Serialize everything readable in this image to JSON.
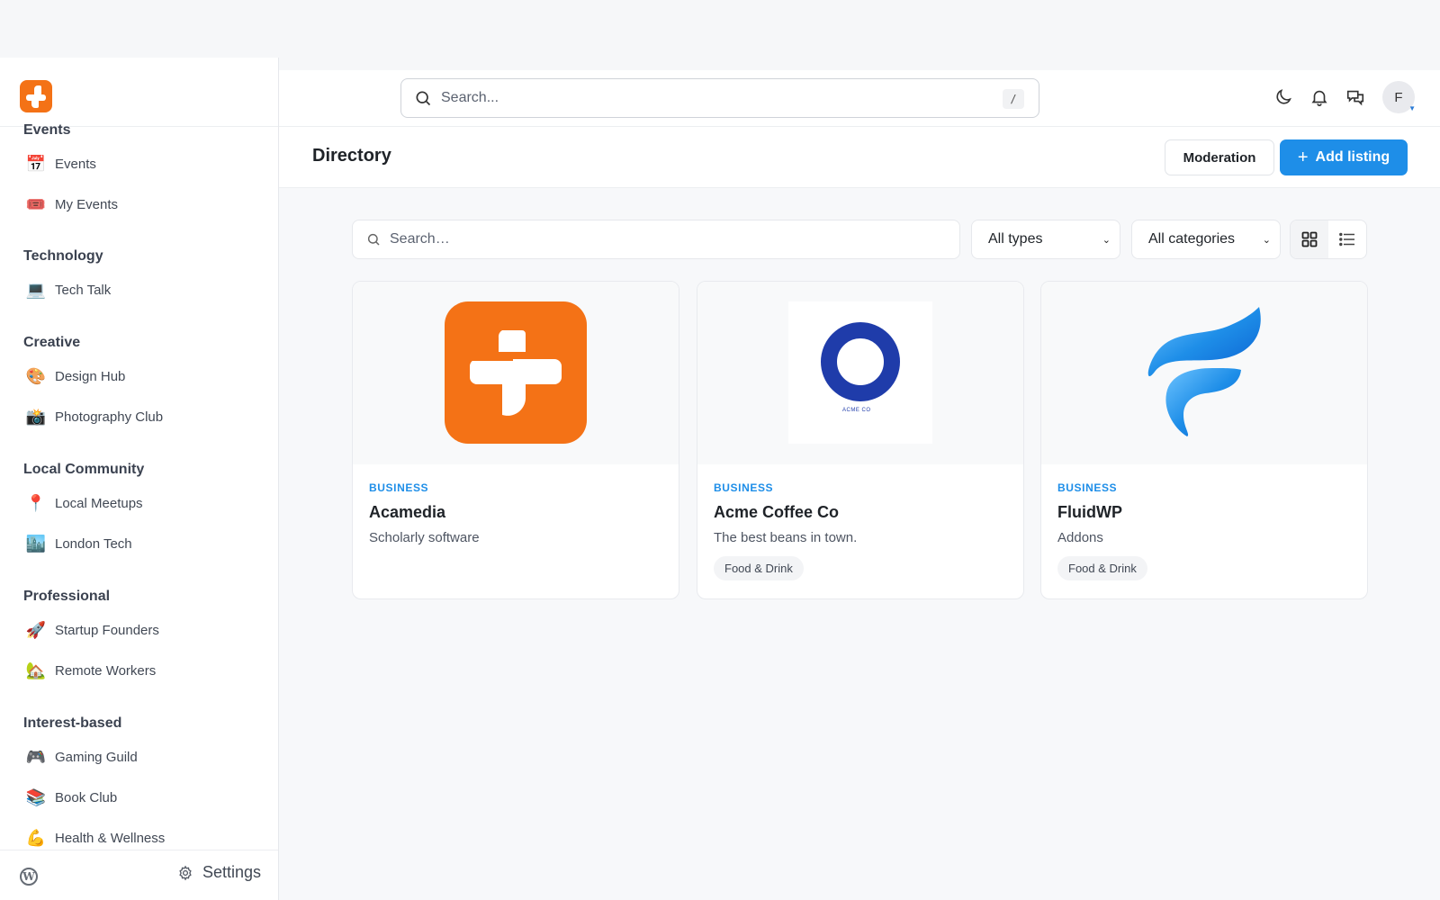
{
  "sidebar": {
    "sections": [
      {
        "title": "Events",
        "items": [
          {
            "label": "Events",
            "emoji": "📅"
          },
          {
            "label": "My Events",
            "emoji": "🎟️"
          }
        ]
      },
      {
        "title": "Technology",
        "items": [
          {
            "label": "Tech Talk",
            "emoji": "💻"
          }
        ]
      },
      {
        "title": "Creative",
        "items": [
          {
            "label": "Design Hub",
            "emoji": "🎨"
          },
          {
            "label": "Photography Club",
            "emoji": "📸"
          }
        ]
      },
      {
        "title": "Local Community",
        "items": [
          {
            "label": "Local Meetups",
            "emoji": "📍"
          },
          {
            "label": "London Tech",
            "emoji": "🏙️"
          }
        ]
      },
      {
        "title": "Professional",
        "items": [
          {
            "label": "Startup Founders",
            "emoji": "🚀"
          },
          {
            "label": "Remote Workers",
            "emoji": "🏡"
          }
        ]
      },
      {
        "title": "Interest-based",
        "items": [
          {
            "label": "Gaming Guild",
            "emoji": "🎮"
          },
          {
            "label": "Book Club",
            "emoji": "📚"
          },
          {
            "label": "Health & Wellness",
            "emoji": "💪"
          }
        ]
      }
    ],
    "footer": {
      "settings_label": "Settings",
      "wp_icon": "W"
    }
  },
  "header": {
    "search_placeholder": "Search...",
    "search_shortcut": "/",
    "avatar_initial": "F",
    "icons": [
      "moon-icon",
      "bell-icon",
      "chat-icon"
    ]
  },
  "page": {
    "title": "Directory",
    "moderation_label": "Moderation",
    "add_label": "Add listing"
  },
  "filters": {
    "search_placeholder": "Search…",
    "type_selected": "All types",
    "category_selected": "All categories"
  },
  "listings": [
    {
      "type": "BUSINESS",
      "name": "Acamedia",
      "description": "Scholarly software",
      "tag": ""
    },
    {
      "type": "BUSINESS",
      "name": "Acme Coffee Co",
      "description": "The best beans in town.",
      "tag": "Food & Drink",
      "logo_text": "ACME CO"
    },
    {
      "type": "BUSINESS",
      "name": "FluidWP",
      "description": "Addons",
      "tag": "Food & Drink"
    }
  ],
  "colors": {
    "accent": "#1e8ee8",
    "brand_orange": "#f47216",
    "acme_blue": "#1f3caa"
  }
}
